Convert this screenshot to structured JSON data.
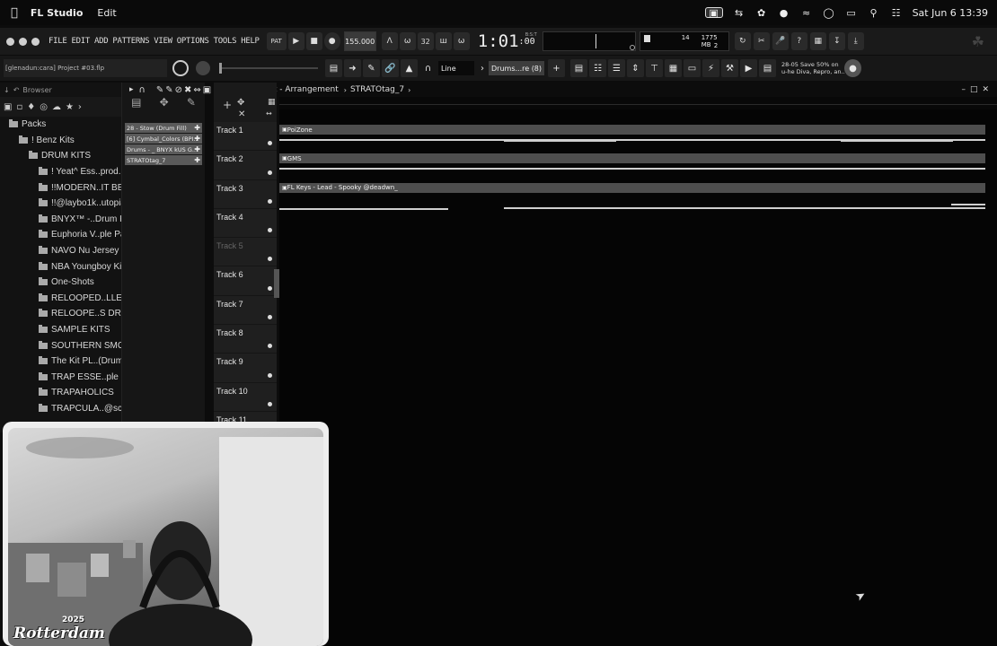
{
  "menubar": {
    "app_name": "FL Studio",
    "menu": [
      "Edit"
    ],
    "clock": "Sat Jun 6  13:39"
  },
  "toolbar": {
    "menus": [
      "FILE",
      "EDIT",
      "ADD",
      "PATTERNS",
      "VIEW",
      "OPTIONS",
      "TOOLS",
      "HELP"
    ],
    "pat_label": "PAT",
    "tempo": "155.000",
    "counter_32": "32",
    "time_display": "1:01",
    "time_sub": ":00",
    "time_unit": "B:S:T",
    "cpu_value": "14",
    "mem_value": "1775 MB",
    "poly_value": "2",
    "news_line1": "28-05  Save 50% on",
    "news_line2": "u-he Diva, Repro, an.."
  },
  "toolbar2": {
    "project_hint": "[glenadun:cara] Project #03.flp",
    "snap_mode": "Line",
    "channel_selector": "Drums...re (8)"
  },
  "browser": {
    "header": "Browser",
    "items": [
      {
        "label": "Packs",
        "level": 0
      },
      {
        "label": "! Benz Kits",
        "level": 1
      },
      {
        "label": "DRUM KITS",
        "level": 2
      },
      {
        "label": "! Yeat^ Ess..prod..stc]",
        "level": 3
      },
      {
        "label": "!!MODERN..IT BE-UP",
        "level": 3
      },
      {
        "label": "!!@laybo1k..utopia kit",
        "level": 3
      },
      {
        "label": "BNYX™ -..Drum Kit)",
        "level": 3
      },
      {
        "label": "Euphoria V..ple Pack",
        "level": 3
      },
      {
        "label": "NAVO Nu Jersey Kit",
        "level": 3
      },
      {
        "label": "NBA Youngboy Kits",
        "level": 3
      },
      {
        "label": "One-Shots",
        "level": 3
      },
      {
        "label": "RELOOPED..LLECTION",
        "level": 3
      },
      {
        "label": "RELOOPE..S DRUMKIT",
        "level": 3
      },
      {
        "label": "SAMPLE KITS",
        "level": 3
      },
      {
        "label": "SOUTHERN SMOKE",
        "level": 3
      },
      {
        "label": "The Kit PL..(Drum Kit)",
        "level": 3
      },
      {
        "label": "TRAP ESSE..ple Pack]",
        "level": 3
      },
      {
        "label": "TRAPAHOLICS",
        "level": 3
      },
      {
        "label": "TRAPCULA..@scarpele",
        "level": 3
      }
    ]
  },
  "picker": {
    "items": [
      "28 - Stow (Drum Fill)",
      "[6] Cymbal_Colors (BPI..",
      "Drums - _ BNYX kUS G..",
      "STRATOtag_7"
    ]
  },
  "playlist": {
    "title": "Playlist - Arrangement",
    "pattern": "STRATOtag_7",
    "tracks": [
      "Track 1",
      "Track 2",
      "Track 3",
      "Track 4",
      "Track 5",
      "Track 6",
      "Track 7",
      "Track 8",
      "Track 9",
      "Track 10",
      "Track 11"
    ],
    "clips": [
      {
        "track": 0,
        "label": "PoiZone"
      },
      {
        "track": 1,
        "label": "GMS"
      },
      {
        "track": 2,
        "label": "FL Keys - Lead - Spooky @deadwn_"
      }
    ]
  },
  "webcam": {
    "watermark": "Rotterdam",
    "watermark_year": "2025"
  },
  "colors": {
    "background": "#0c0c0c",
    "panel": "#1a1a1a",
    "clip": "#4e4e4e"
  }
}
